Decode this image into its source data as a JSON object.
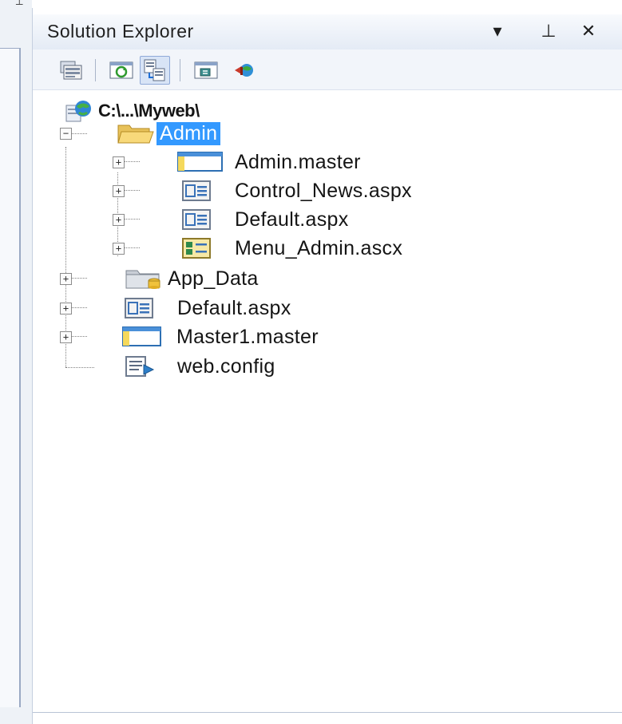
{
  "panel": {
    "title": "Solution Explorer",
    "title_buttons": [
      "▾",
      "⊥",
      "✕"
    ],
    "toolbar": [
      {
        "name": "properties",
        "icon": "properties-icon"
      },
      {
        "name": "refresh",
        "icon": "refresh-icon"
      },
      {
        "name": "nest-related-files",
        "icon": "nest-related-files-icon",
        "pressed": true
      },
      {
        "name": "view-designer",
        "icon": "view-designer-icon"
      },
      {
        "name": "asp-net-configuration",
        "icon": "asp-net-configuration-icon"
      }
    ]
  },
  "tree": {
    "root": {
      "label": "C:\\...\\Myweb\\",
      "icon": "website-globe-icon"
    },
    "items": [
      {
        "label": "Admin",
        "icon": "open-folder-icon",
        "expanded": true,
        "selected": true,
        "children": [
          {
            "label": "Admin.master",
            "icon": "master-page-icon"
          },
          {
            "label": "Control_News.aspx",
            "icon": "aspx-page-icon"
          },
          {
            "label": "Default.aspx",
            "icon": "aspx-page-icon"
          },
          {
            "label": "Menu_Admin.ascx",
            "icon": "user-control-icon"
          }
        ]
      },
      {
        "label": "App_Data",
        "icon": "app-data-folder-icon"
      },
      {
        "label": "Default.aspx",
        "icon": "aspx-page-icon"
      },
      {
        "label": "Master1.master",
        "icon": "master-page-icon"
      },
      {
        "label": "web.config",
        "icon": "config-file-icon"
      }
    ]
  }
}
